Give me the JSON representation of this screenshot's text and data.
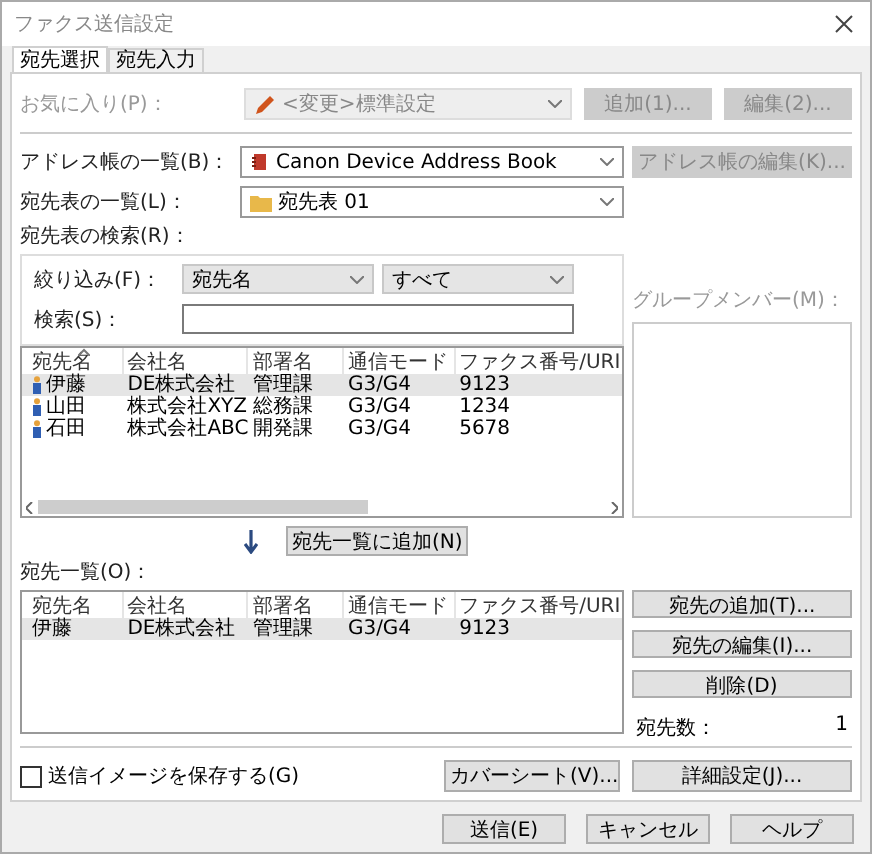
{
  "window": {
    "title": "ファクス送信設定"
  },
  "tabs": [
    {
      "label": "宛先選択",
      "selected": true
    },
    {
      "label": "宛先入力",
      "selected": false
    }
  ],
  "favorites": {
    "label": "お気に入り(P)：",
    "value": "<変更>標準設定",
    "disabled": true,
    "buttons": [
      {
        "label": "追加(1)...",
        "disabled": true
      },
      {
        "label": "編集(2)...",
        "disabled": true
      }
    ]
  },
  "address_book": {
    "label": "アドレス帳の一覧(B)：",
    "value": "Canon Device Address Book",
    "edit_button": {
      "label": "アドレス帳の編集(K)...",
      "disabled": true
    }
  },
  "destination_table": {
    "label": "宛先表の一覧(L)：",
    "value": "宛先表 01"
  },
  "search": {
    "label": "宛先表の検索(R)：",
    "filter_label": "絞り込み(F)：",
    "filter_field": "宛先名",
    "filter_scope": "すべて",
    "search_label": "検索(S)："
  },
  "group_members": {
    "label": "グループメンバー(M)：",
    "disabled": true
  },
  "results": {
    "columns": [
      "宛先名",
      "会社名",
      "部署名",
      "通信モード",
      "ファクス番号/URI"
    ],
    "rows": [
      {
        "cells": [
          "伊藤",
          "DE株式会社",
          "管理課",
          "G3/G4",
          "9123"
        ],
        "selected": true
      },
      {
        "cells": [
          "山田",
          "株式会社XYZ",
          "総務課",
          "G3/G4",
          "1234"
        ],
        "selected": false
      },
      {
        "cells": [
          "石田",
          "株式会社ABC",
          "開発課",
          "G3/G4",
          "5678"
        ],
        "selected": false
      }
    ]
  },
  "add_to_list_button": "宛先一覧に追加(N)",
  "destinations": {
    "label": "宛先一覧(O)：",
    "columns": [
      "宛先名",
      "会社名",
      "部署名",
      "通信モード",
      "ファクス番号/URI"
    ],
    "rows": [
      {
        "cells": [
          "伊藤",
          "DE株式会社",
          "管理課",
          "G3/G4",
          "9123"
        ],
        "selected": true
      }
    ]
  },
  "side_buttons": [
    "宛先の追加(T)...",
    "宛先の編集(I)...",
    "削除(D)"
  ],
  "count": {
    "label": "宛先数：",
    "value": "1"
  },
  "save_image": {
    "label": "送信イメージを保存する(G)",
    "checked": false
  },
  "cover_sheet_button": "カバーシート(V)...",
  "details_button": "詳細設定(J)...",
  "footer_buttons": [
    "送信(E)",
    "キャンセル",
    "ヘルプ"
  ]
}
